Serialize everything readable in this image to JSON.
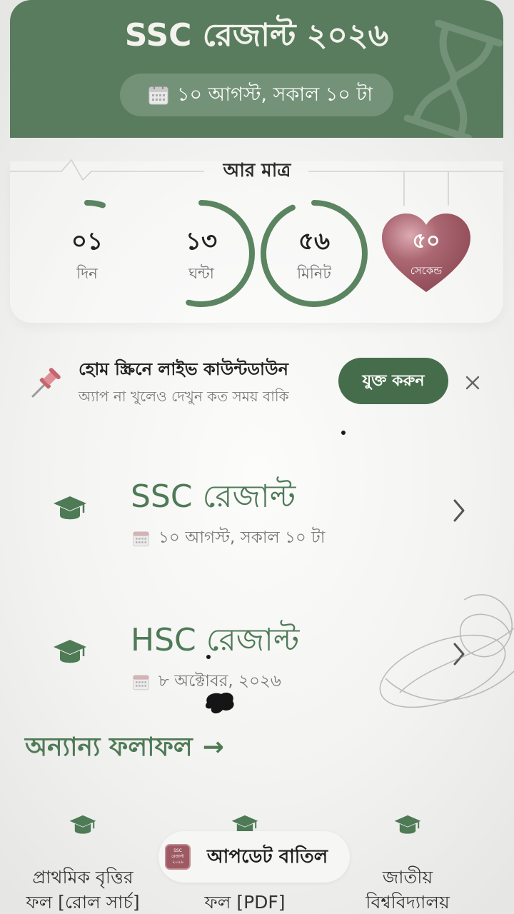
{
  "header": {
    "title": "SSC রেজাল্ট ২০২৬",
    "date_pill": {
      "icon": "calendar-icon",
      "text": "১০ আগস্ট, সকাল ১০ টা"
    },
    "watermark_icon": "hourglass-icon"
  },
  "countdown": {
    "label": "আর মাত্র",
    "units": [
      {
        "value": "০১",
        "label": "দিন",
        "progress": 0.05
      },
      {
        "value": "১৩",
        "label": "ঘন্টা",
        "progress": 0.54
      },
      {
        "value": "৫৬",
        "label": "মিনিট",
        "progress": 0.93
      },
      {
        "value": "৫০",
        "label": "সেকেন্ড",
        "shape": "heart"
      }
    ]
  },
  "widget_banner": {
    "icon": "pushpin-icon",
    "title": "হোম স্ক্রিনে লাইভ কাউন্টডাউন",
    "subtitle": "অ্যাপ না খুলেও দেখুন কত সময় বাকি",
    "button_label": "যুক্ত করুন",
    "close_icon": "close-icon"
  },
  "results": [
    {
      "icon": "graduation-cap-icon",
      "title": "SSC রেজাল্ট",
      "date_icon": "calendar-icon",
      "date": "১০ আগস্ট, সকাল ১০ টা"
    },
    {
      "icon": "graduation-cap-icon",
      "title": "HSC রেজাল্ট",
      "date_icon": "calendar-icon",
      "date": "৮ অক্টোবর, ২০২৬"
    }
  ],
  "other_results": {
    "heading": "অন্যান্য ফলাফল",
    "arrow": "→",
    "items": [
      {
        "icon": "graduation-cap-icon",
        "lines": [
          "প্রাথমিক বৃত্তির",
          "ফল [রোল সার্চ]"
        ]
      },
      {
        "icon": "graduation-cap-icon",
        "lines": [
          "ফল [PDF]"
        ]
      },
      {
        "icon": "graduation-cap-icon",
        "lines": [
          "জাতীয়",
          "বিশ্ববিদ্যালয়"
        ]
      }
    ]
  },
  "toast": {
    "app_icon_text": [
      "SSC",
      "রেজাল্ট",
      "২০২৬"
    ],
    "message": "আপডেট বাতিল"
  },
  "colors": {
    "primary_green": "#587c5d",
    "button_green": "#466d4b",
    "title_green": "#4f7a57",
    "ring_green": "#5b8461",
    "heart_maroon": "#a25d68",
    "text_dark": "#262626",
    "text_muted": "#7a7a7a"
  }
}
